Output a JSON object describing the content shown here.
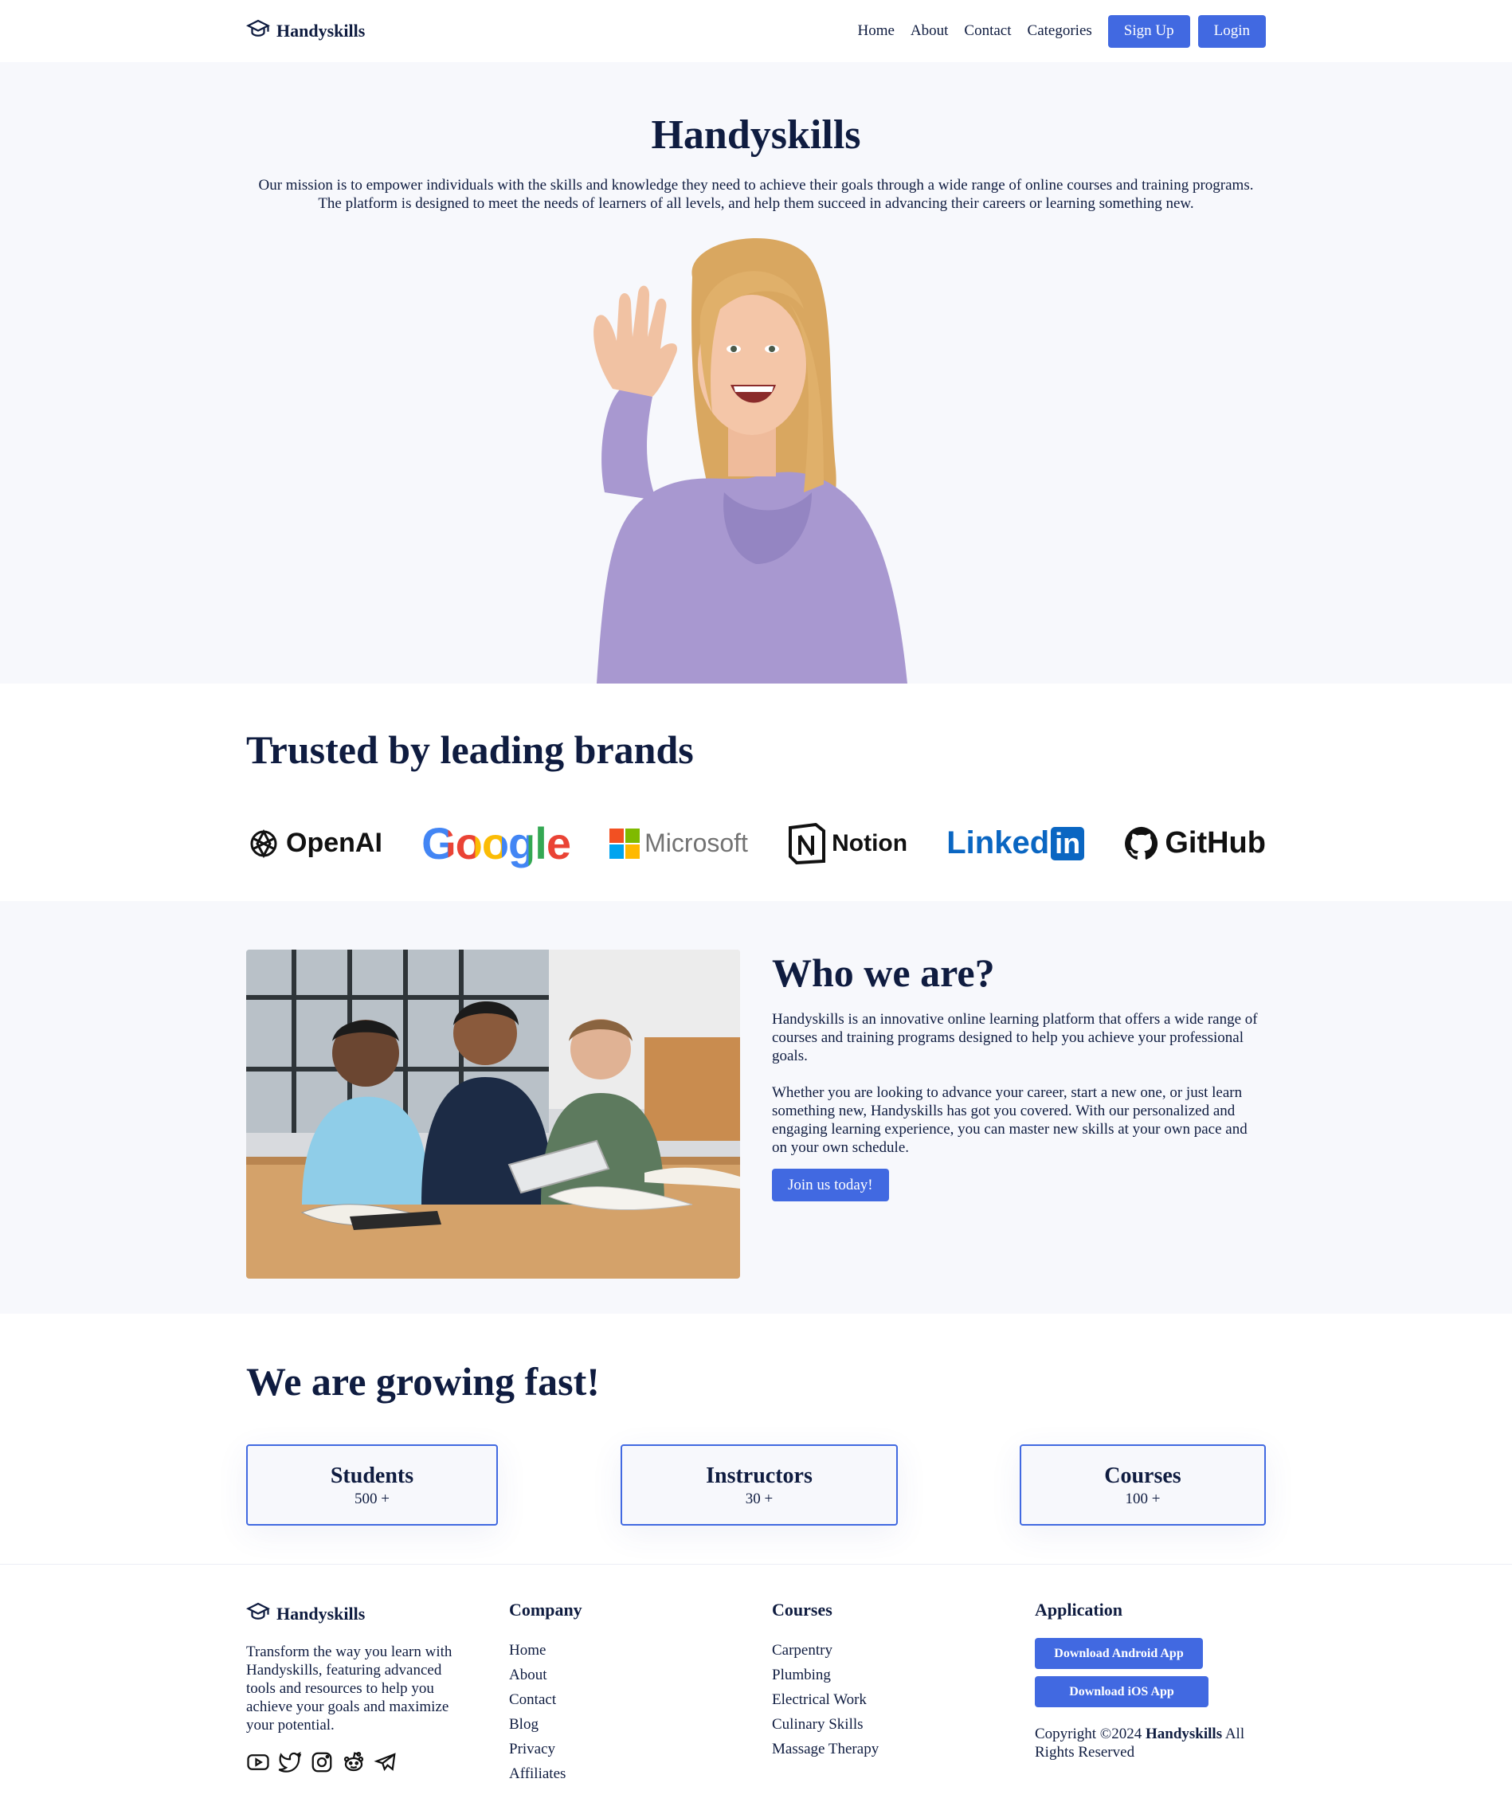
{
  "nav": {
    "brand": "Handyskills",
    "links": [
      "Home",
      "About",
      "Contact",
      "Categories"
    ],
    "signup": "Sign Up",
    "login": "Login"
  },
  "hero": {
    "title": "Handyskills",
    "text": "Our mission is to empower individuals with the skills and knowledge they need to achieve their goals through a wide range of online courses and training programs. The platform is designed to meet the needs of learners of all levels, and help them succeed in advancing their careers or learning something new."
  },
  "brands": {
    "title": "Trusted by leading brands",
    "logos": [
      "OpenAI",
      "Google",
      "Microsoft",
      "Notion",
      "Linked",
      "in",
      "GitHub"
    ]
  },
  "who": {
    "title": "Who we are?",
    "p1": "Handyskills is an innovative online learning platform that offers a wide range of courses and training programs designed to help you achieve your professional goals.",
    "p2": "Whether you are looking to advance your career, start a new one, or just learn something new, Handyskills has got you covered. With our personalized and engaging learning experience, you can master new skills at your own pace and on your own schedule.",
    "cta": "Join us today!"
  },
  "growth": {
    "title": "We are growing fast!",
    "stats": [
      {
        "label": "Students",
        "value": "500 +"
      },
      {
        "label": "Instructors",
        "value": "30 +"
      },
      {
        "label": "Courses",
        "value": "100 +"
      }
    ]
  },
  "footer": {
    "brand": "Handyskills",
    "desc": "Transform the way you learn with Handyskills, featuring advanced tools and resources to help you achieve your goals and maximize your potential.",
    "company_title": "Company",
    "company": [
      "Home",
      "About",
      "Contact",
      "Blog",
      "Privacy",
      "Affiliates"
    ],
    "courses_title": "Courses",
    "courses": [
      "Carpentry",
      "Plumbing",
      "Electrical Work",
      "Culinary Skills",
      "Massage Therapy"
    ],
    "app_title": "Application",
    "android": "Download Android App",
    "ios": "Download iOS App",
    "copy_prefix": "Copyright ©2024",
    "copy_brand": "Handyskills",
    "copy_suffix": "All Rights Reserved"
  },
  "colors": {
    "accent": "#4169e1",
    "text": "#0f1c40",
    "section_bg": "#f7f8fc"
  },
  "icons": [
    "graduation-cap-icon",
    "youtube-icon",
    "twitter-icon",
    "instagram-icon",
    "reddit-icon",
    "telegram-icon"
  ]
}
